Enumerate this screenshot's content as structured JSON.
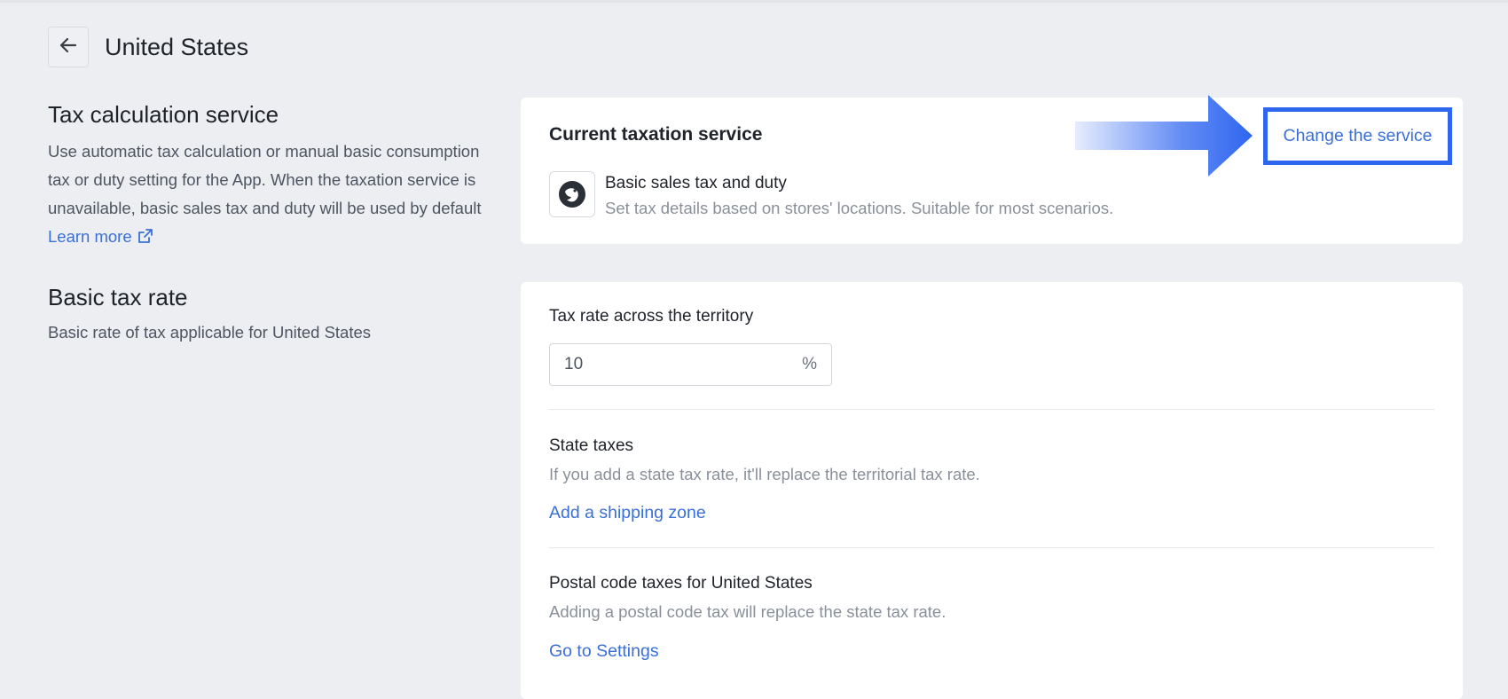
{
  "header": {
    "title": "United States"
  },
  "tax_service_section": {
    "title": "Tax calculation service",
    "description": "Use automatic tax calculation or manual basic consumption tax or duty setting for the App. When the taxation service is unavailable, basic sales tax and duty will be used by default",
    "learn_more": "Learn more"
  },
  "basic_rate_section": {
    "title": "Basic tax rate",
    "description": "Basic rate of tax applicable for United States"
  },
  "current_service_card": {
    "heading": "Current taxation service",
    "service_name": "Basic sales tax and duty",
    "service_description": "Set tax details based on stores' locations. Suitable for most scenarios.",
    "change_label": "Change the service"
  },
  "rate_card": {
    "territory_label": "Tax rate across the territory",
    "territory_value": "10",
    "unit": "%",
    "state": {
      "title": "State taxes",
      "description": "If you add a state tax rate, it'll replace the territorial tax rate.",
      "link": "Add a shipping zone"
    },
    "postal": {
      "title": "Postal code taxes for United States",
      "description": "Adding a postal code tax will replace the state tax rate.",
      "link": "Go to Settings"
    }
  },
  "colors": {
    "accent": "#3a6fd8",
    "highlight": "#2f66f0",
    "background": "#eceef1"
  }
}
